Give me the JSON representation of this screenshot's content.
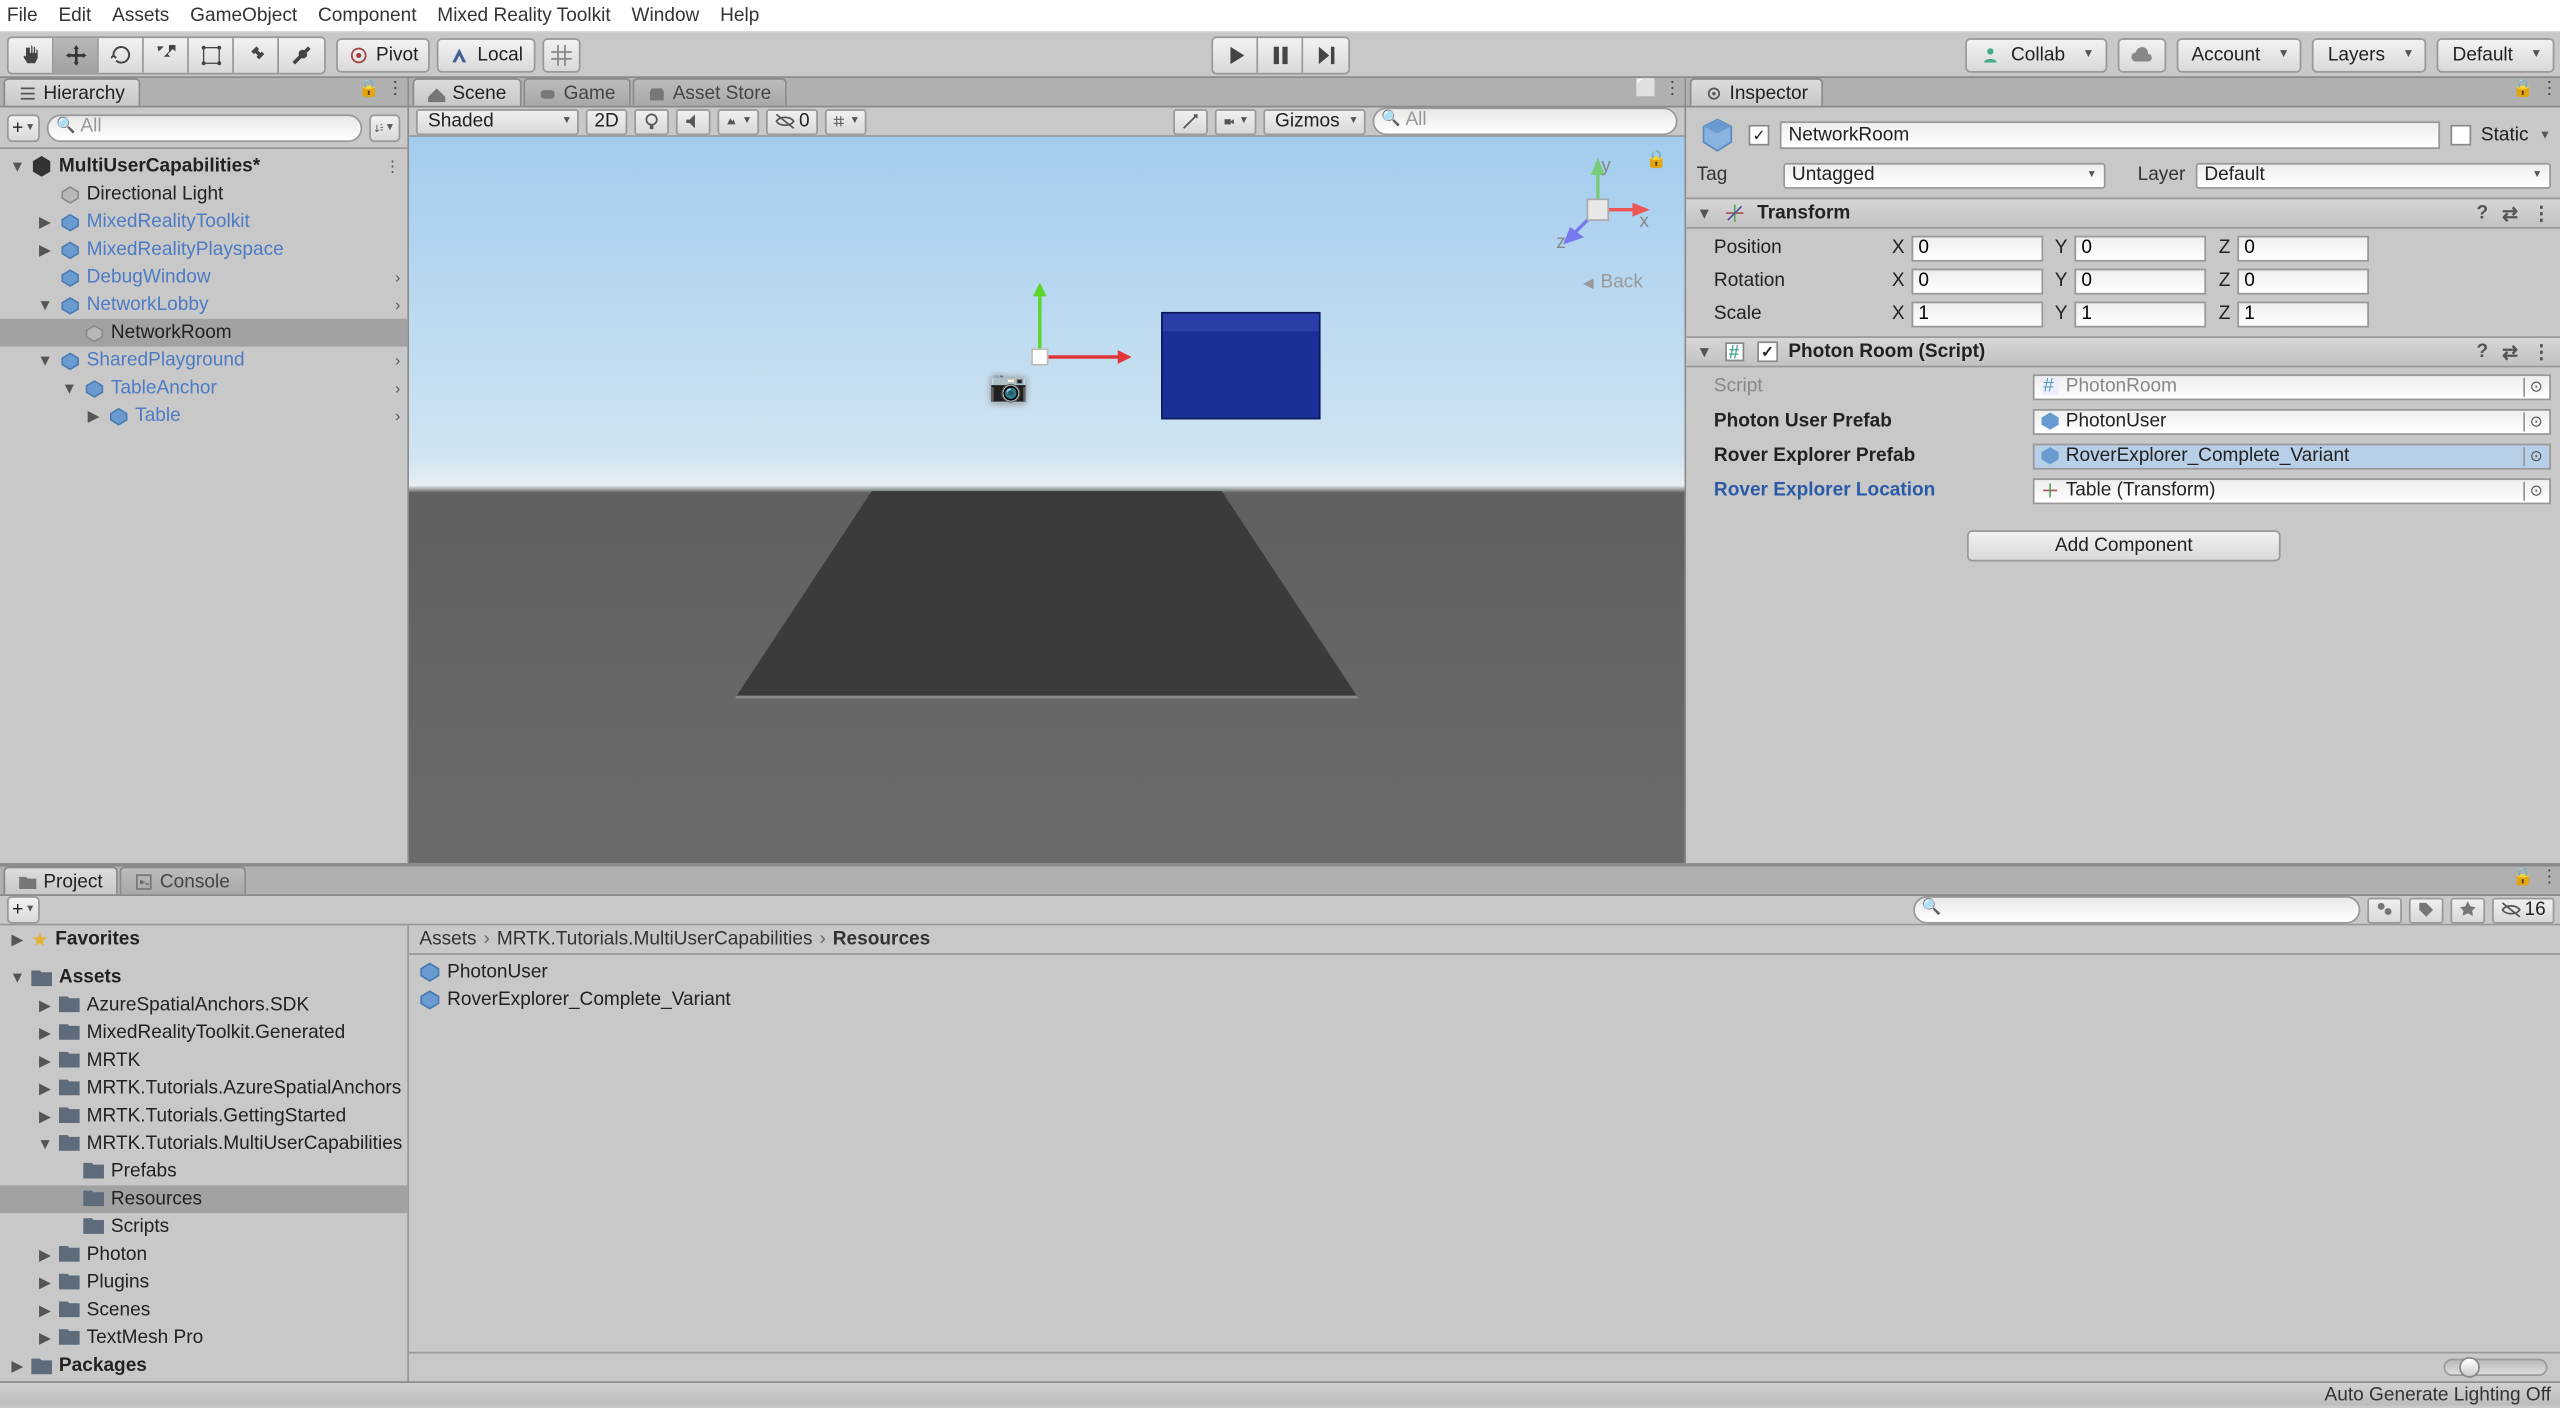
{
  "menubar": [
    "File",
    "Edit",
    "Assets",
    "GameObject",
    "Component",
    "Mixed Reality Toolkit",
    "Window",
    "Help"
  ],
  "toolbar": {
    "pivot": "Pivot",
    "local": "Local",
    "collab": "Collab",
    "account": "Account",
    "layers": "Layers",
    "layout": "Default"
  },
  "hierarchy": {
    "tab": "Hierarchy",
    "search_placeholder": "All",
    "scene": "MultiUserCapabilities*",
    "items": [
      {
        "indent": 1,
        "fold": "none",
        "blue": false,
        "label": "Directional Light"
      },
      {
        "indent": 1,
        "fold": "col",
        "blue": true,
        "label": "MixedRealityToolkit"
      },
      {
        "indent": 1,
        "fold": "col",
        "blue": true,
        "label": "MixedRealityPlayspace"
      },
      {
        "indent": 1,
        "fold": "none",
        "blue": true,
        "label": "DebugWindow",
        "more": true
      },
      {
        "indent": 1,
        "fold": "exp",
        "blue": true,
        "label": "NetworkLobby",
        "more": true
      },
      {
        "indent": 2,
        "fold": "none",
        "blue": false,
        "label": "NetworkRoom",
        "highlight": true
      },
      {
        "indent": 1,
        "fold": "exp",
        "blue": true,
        "label": "SharedPlayground",
        "more": true
      },
      {
        "indent": 2,
        "fold": "exp",
        "blue": true,
        "label": "TableAnchor",
        "more": true
      },
      {
        "indent": 3,
        "fold": "col",
        "blue": true,
        "label": "Table",
        "more": true
      }
    ]
  },
  "center": {
    "tabs": [
      "Scene",
      "Game",
      "Asset Store"
    ],
    "shaded": "Shaded",
    "twod": "2D",
    "gizmos": "Gizmos",
    "search_placeholder": "All",
    "zero": "0",
    "back": "Back"
  },
  "inspector": {
    "tab": "Inspector",
    "name": "NetworkRoom",
    "static": "Static",
    "tag_label": "Tag",
    "tag_val": "Untagged",
    "layer_label": "Layer",
    "layer_val": "Default",
    "transform": {
      "title": "Transform",
      "rows": [
        {
          "label": "Position",
          "x": "0",
          "y": "0",
          "z": "0"
        },
        {
          "label": "Rotation",
          "x": "0",
          "y": "0",
          "z": "0"
        },
        {
          "label": "Scale",
          "x": "1",
          "y": "1",
          "z": "1"
        }
      ]
    },
    "photon": {
      "title": "Photon Room (Script)",
      "script_label": "Script",
      "script_val": "PhotonRoom",
      "prefab_label": "Photon User Prefab",
      "prefab_val": "PhotonUser",
      "rover_label": "Rover Explorer Prefab",
      "rover_val": "RoverExplorer_Complete_Variant",
      "loc_label": "Rover Explorer Location",
      "loc_val": "Table (Transform)"
    },
    "add_component": "Add Component"
  },
  "project": {
    "tabs": [
      "Project",
      "Console"
    ],
    "count": "16",
    "favorites": "Favorites",
    "assets_root": "Assets",
    "packages": "Packages",
    "folders": [
      {
        "indent": 1,
        "fold": "col",
        "label": "AzureSpatialAnchors.SDK"
      },
      {
        "indent": 1,
        "fold": "col",
        "label": "MixedRealityToolkit.Generated"
      },
      {
        "indent": 1,
        "fold": "col",
        "label": "MRTK"
      },
      {
        "indent": 1,
        "fold": "col",
        "label": "MRTK.Tutorials.AzureSpatialAnchors"
      },
      {
        "indent": 1,
        "fold": "col",
        "label": "MRTK.Tutorials.GettingStarted"
      },
      {
        "indent": 1,
        "fold": "exp",
        "label": "MRTK.Tutorials.MultiUserCapabilities"
      },
      {
        "indent": 2,
        "fold": "none",
        "label": "Prefabs"
      },
      {
        "indent": 2,
        "fold": "none",
        "label": "Resources",
        "selected": true
      },
      {
        "indent": 2,
        "fold": "none",
        "label": "Scripts"
      },
      {
        "indent": 1,
        "fold": "col",
        "label": "Photon"
      },
      {
        "indent": 1,
        "fold": "col",
        "label": "Plugins"
      },
      {
        "indent": 1,
        "fold": "col",
        "label": "Scenes"
      },
      {
        "indent": 1,
        "fold": "col",
        "label": "TextMesh Pro"
      }
    ],
    "breadcrumb": [
      "Assets",
      "MRTK.Tutorials.MultiUserCapabilities",
      "Resources"
    ],
    "files": [
      "PhotonUser",
      "RoverExplorer_Complete_Variant"
    ]
  },
  "statusbar": "Auto Generate Lighting Off"
}
